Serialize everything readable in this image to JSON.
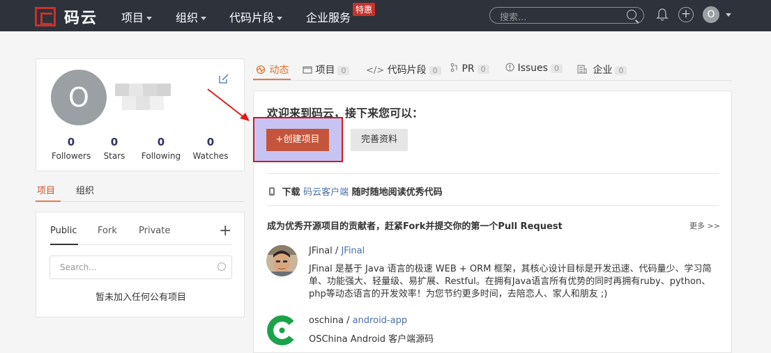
{
  "nav": {
    "logo_text": "码云",
    "items": [
      {
        "label": "项目",
        "has_caret": true
      },
      {
        "label": "组织",
        "has_caret": true
      },
      {
        "label": "代码片段",
        "has_caret": true
      },
      {
        "label": "企业服务",
        "has_caret": false
      }
    ],
    "hot_badge": "特惠",
    "search_placeholder": "搜索...",
    "user_initial": "O"
  },
  "profile": {
    "avatar_initial": "O",
    "stats": [
      {
        "value": "0",
        "label": "Followers"
      },
      {
        "value": "0",
        "label": "Stars"
      },
      {
        "value": "0",
        "label": "Following"
      },
      {
        "value": "0",
        "label": "Watches"
      }
    ]
  },
  "left_tabs": [
    {
      "label": "项目",
      "active": true
    },
    {
      "label": "组织",
      "active": false
    }
  ],
  "projects_panel": {
    "filters": [
      "Public",
      "Fork",
      "Private"
    ],
    "add_label": "+",
    "search_placeholder": "Search...",
    "empty_text": "暂未加入任何公有项目"
  },
  "main_tabs": [
    {
      "label": "动态",
      "count": "",
      "active": true,
      "icon": "activity-icon"
    },
    {
      "label": "项目",
      "count": "0",
      "active": false,
      "icon": "folder-icon"
    },
    {
      "label": "代码片段",
      "count": "0",
      "active": false,
      "icon": "code-icon"
    },
    {
      "label": "PR",
      "count": "0",
      "active": false,
      "icon": "pull-request-icon"
    },
    {
      "label": "Issues",
      "count": "0",
      "active": false,
      "icon": "info-icon"
    },
    {
      "label": "企业",
      "count": "0",
      "active": false,
      "icon": "building-icon"
    }
  ],
  "welcome": {
    "title": "欢迎来到码云，接下来您可以：",
    "create_button": "+创建项目",
    "profile_button": "完善资料"
  },
  "download": {
    "prefix": "下载",
    "link": "码云客户端",
    "suffix": "随时随地阅读优秀代码"
  },
  "contribute": {
    "title": "成为优秀开源项目的贡献者，赶紧Fork并提交你的第一个Pull Request",
    "more": "更多 >>"
  },
  "featured": [
    {
      "owner": "JFinal",
      "sep": " / ",
      "name": "JFinal",
      "desc": "JFinal 是基于 Java 语言的极速 WEB + ORM 框架，其核心设计目标是开发迅速、代码量少、学习简单、功能强大、轻量级、易扩展、Restful。在拥有Java语言所有优势的同时再拥有ruby、python、php等动态语言的开发效率！为您节约更多时间，去陪恋人、家人和朋友 ;)"
    },
    {
      "owner": "oschina",
      "sep": " / ",
      "name": "android-app",
      "desc": "OSChina Android 客户端源码"
    }
  ],
  "colors": {
    "nav_bg": "#2d323b",
    "brand_red": "#c7332d",
    "accent_orange": "#e07b4a",
    "link_blue": "#4a6fa5",
    "highlight_border": "#d9141b",
    "highlight_fill": "#c7c4f4"
  }
}
